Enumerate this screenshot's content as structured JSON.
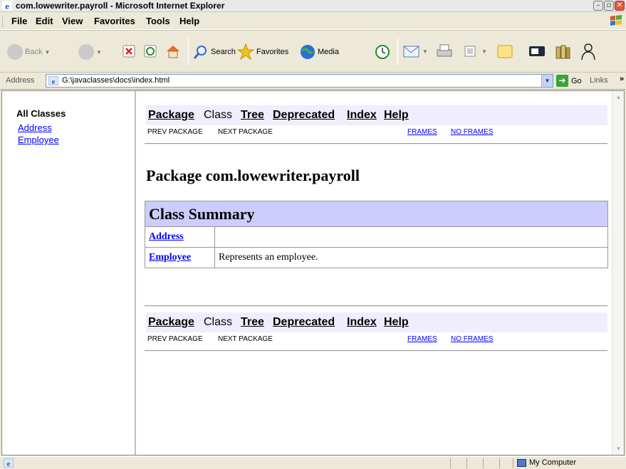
{
  "window": {
    "title": "com.lowewriter.payroll - Microsoft Internet Explorer"
  },
  "menu": {
    "items": [
      "File",
      "Edit",
      "View",
      "Favorites",
      "Tools",
      "Help"
    ]
  },
  "toolbar": {
    "back_label": "Back",
    "search_label": "Search",
    "favorites_label": "Favorites",
    "media_label": "Media"
  },
  "address": {
    "label": "Address",
    "url": "G:\\javaclasses\\docs\\index.html",
    "go_label": "Go",
    "links_label": "Links"
  },
  "left_frame": {
    "heading": "All Classes",
    "classes": [
      "Address",
      "Employee"
    ]
  },
  "navbar": {
    "package": "Package",
    "class": "Class",
    "tree": "Tree",
    "deprecated": "Deprecated",
    "index": "Index",
    "help": "Help",
    "prev_package": "PREV PACKAGE",
    "next_package": "NEXT PACKAGE",
    "frames": "FRAMES",
    "no_frames": "NO FRAMES"
  },
  "main": {
    "package_title": "Package com.lowewriter.payroll",
    "summary_header": "Class Summary",
    "rows": [
      {
        "name": "Address",
        "description": ""
      },
      {
        "name": "Employee",
        "description": "Represents an employee."
      }
    ]
  },
  "status": {
    "zone": "My Computer"
  },
  "colors": {
    "nav_background": "#eeeeff",
    "summary_header": "#ccccff",
    "link": "#0000ff"
  }
}
